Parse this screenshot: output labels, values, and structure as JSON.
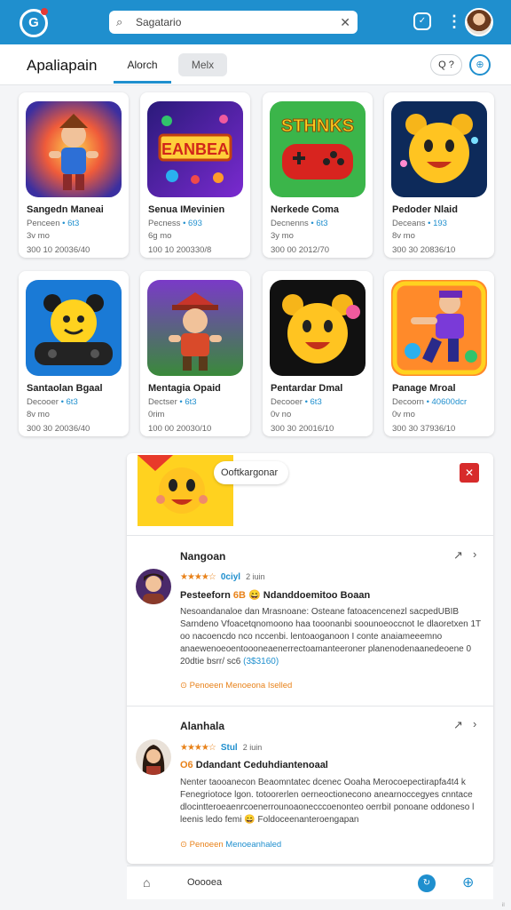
{
  "topbar": {
    "logo": "G",
    "search_placeholder": "Sagatario",
    "search_icon": "search-icon",
    "clear_icon": "close-icon",
    "shield_icon": "shield-icon",
    "menu_icon": "more-vert-icon",
    "colors": {
      "bar": "#1f8fce"
    }
  },
  "header": {
    "title": "Apaliapain",
    "tabs": [
      {
        "label": "Alorch"
      },
      {
        "label": "Melx"
      }
    ],
    "button_search": "Q ?",
    "button_account": "⊕"
  },
  "cards": [
    {
      "title": "Sangedn Maneai",
      "line1_a": "Penceen",
      "line1_b": "• 6t3",
      "line2": "3v mo",
      "line3": "300 10 20036/40"
    },
    {
      "title": "Senua IMevinien",
      "line1_a": "Pecness",
      "line1_b": "• 693",
      "line2": "6g mo",
      "line3": "100 10 200330/8"
    },
    {
      "title": "Nerkede Coma",
      "line1_a": "Decnenns",
      "line1_b": "• 6t3",
      "line2": "3y mo",
      "line3": "300 00 2012/70"
    },
    {
      "title": "Pedoder Nlaid",
      "line1_a": "Deceans",
      "line1_b": "• 193",
      "line2": "8v mo",
      "line3": "300 30 20836/10"
    },
    {
      "title": "Santaolan Bgaal",
      "line1_a": "Decooer",
      "line1_b": "• 6t3",
      "line2": "8v mo",
      "line3": "300 30 20036/40"
    },
    {
      "title": "Mentagia Opaid",
      "line1_a": "Dectser",
      "line1_b": "• 6t3",
      "line2": "0rim",
      "line3": "100 00 20030/10"
    },
    {
      "title": "Pentardar Dmal",
      "line1_a": "Decooer",
      "line1_b": "• 6t3",
      "line2": "0v no",
      "line3": "300 30 20016/10"
    },
    {
      "title": "Panage Mroal",
      "line1_a": "Decoorn",
      "line1_b": "• 40600dcr",
      "line2": "0v mo",
      "line3": "300 30 37936/10"
    }
  ],
  "panel": {
    "pill_label": "Ooftkargonar",
    "close_icon": "close-icon",
    "reviews": [
      {
        "section_title": "Nangoan",
        "rating_label": "0ciyl",
        "rating_meta": "2 iuin",
        "headline_a": "Pesteeforn",
        "headline_b": "6B",
        "headline_c": "Ndanddoemitoo Boaan",
        "body": "Nesoandanaloe dan Mrasnoane: Osteane fatoacencenezl sacpedUBIB Sarndeno Vfoacetqnomoono haa tooonanbi soounoeoccnot Ie dlaoretxen 1T oo nacoencdo nco nccenbi. lentoaoganoon I conte anaiameeemno anaewenoeoentoooneaenerrectoamanteeroner planenodenaanedeoene 0 20dtie bsrr/ sc6",
        "body_link": "(3$3160)",
        "foot_a": "Penoeen",
        "foot_b": "Menoeona Iselled"
      },
      {
        "section_title": "Alanhala",
        "rating_label": "Stul",
        "rating_meta": "2 iuin",
        "headline_a": "O6",
        "headline_b": "Ddandant Ceduhdiantenoaal",
        "body": "Nenter taooanecon Beaomntatec dcenec Ooaha Merocoepectirapfa4t4 k Fenegriotoce lgon. totoorerlen oerneoctionecono anearnoccegyes cnntace dlocintteroeaenrcoenerrounoaonecccoenonteo oerrbiI ponoane oddoneso l leenis ledo femi",
        "body_extra": "Foldoceenanteroengapan",
        "foot_a": "Penoeen",
        "foot_b": "Menoeanhaled"
      }
    ]
  },
  "bottombar": {
    "label": "Ooooea",
    "home_icon": "home-icon",
    "sync_icon": "sync-icon",
    "globe_icon": "globe-icon"
  },
  "corner_text": "il"
}
